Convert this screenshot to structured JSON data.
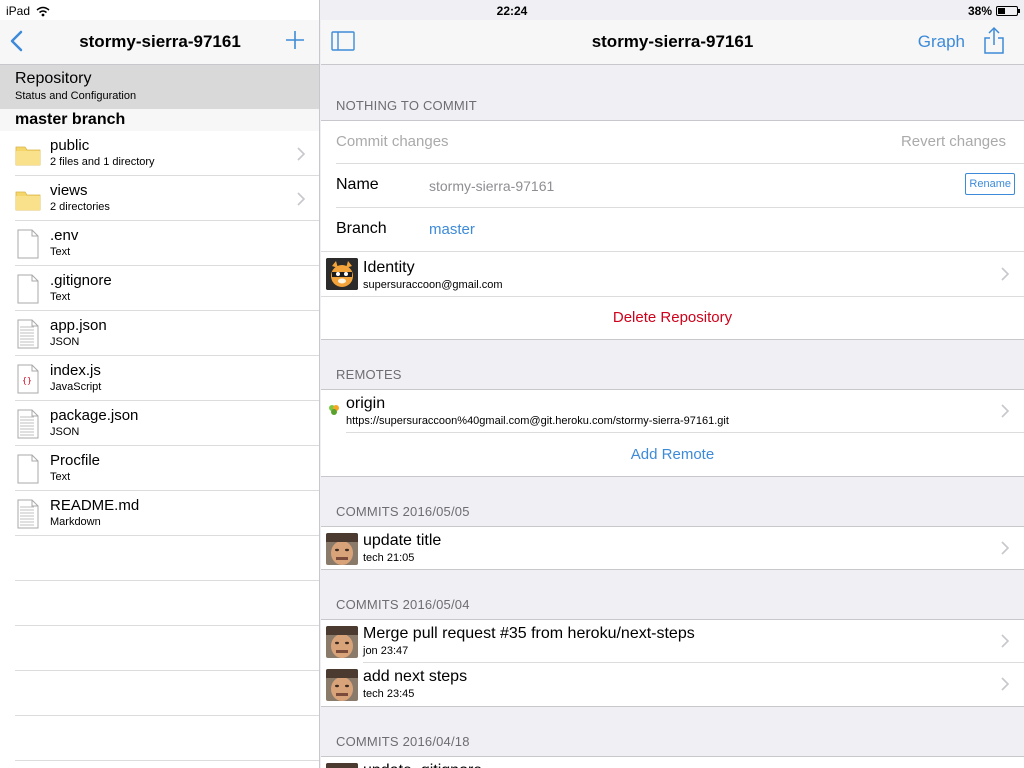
{
  "status_bar": {
    "device": "iPad",
    "time": "22:24",
    "battery_percent": "38%",
    "battery_level": 0.38
  },
  "left_pane": {
    "nav_title": "stormy-sierra-97161",
    "repository_row": {
      "title": "Repository",
      "subtitle": "Status and Configuration"
    },
    "branch_header": "master branch",
    "files": [
      {
        "name": "public",
        "subtitle": "2 files and 1 directory",
        "icon": "folder-icon",
        "has_chevron": true
      },
      {
        "name": "views",
        "subtitle": "2 directories",
        "icon": "folder-icon",
        "has_chevron": true
      },
      {
        "name": ".env",
        "subtitle": "Text",
        "icon": "blank-file-icon",
        "has_chevron": false
      },
      {
        "name": ".gitignore",
        "subtitle": "Text",
        "icon": "blank-file-icon",
        "has_chevron": false
      },
      {
        "name": "app.json",
        "subtitle": "JSON",
        "icon": "text-file-icon",
        "has_chevron": false
      },
      {
        "name": "index.js",
        "subtitle": "JavaScript",
        "icon": "code-file-icon",
        "has_chevron": false
      },
      {
        "name": "package.json",
        "subtitle": "JSON",
        "icon": "text-file-icon",
        "has_chevron": false
      },
      {
        "name": "Procfile",
        "subtitle": "Text",
        "icon": "blank-file-icon",
        "has_chevron": false
      },
      {
        "name": "README.md",
        "subtitle": "Markdown",
        "icon": "text-file-icon",
        "has_chevron": false
      }
    ]
  },
  "right_pane": {
    "nav_title": "stormy-sierra-97161",
    "graph_label": "Graph",
    "status_section": {
      "header": "NOTHING TO COMMIT",
      "commit_changes": "Commit changes",
      "revert_changes": "Revert changes",
      "name_label": "Name",
      "name_value": "stormy-sierra-97161",
      "rename_label": "Rename",
      "branch_label": "Branch",
      "branch_value": "master",
      "identity_title": "Identity",
      "identity_email": "supersuraccoon@gmail.com",
      "delete_label": "Delete Repository"
    },
    "remotes_section": {
      "header": "REMOTES",
      "remote_name": "origin",
      "remote_url": "https://supersuraccoon%40gmail.com@git.heroku.com/stormy-sierra-97161.git",
      "add_remote_label": "Add Remote"
    },
    "commit_groups": [
      {
        "header": "COMMITS 2016/05/05",
        "commits": [
          {
            "title": "update title",
            "meta": "tech 21:05"
          }
        ]
      },
      {
        "header": "COMMITS 2016/05/04",
        "commits": [
          {
            "title": "Merge pull request #35 from heroku/next-steps",
            "meta": "jon 23:47"
          },
          {
            "title": "add next steps",
            "meta": "tech 23:45"
          }
        ]
      },
      {
        "header": "COMMITS 2016/04/18",
        "commits": [
          {
            "title": "update .gitignore",
            "meta": ""
          }
        ]
      }
    ]
  },
  "colors": {
    "accent_blue": "#3d8bd8",
    "destructive_red": "#d0021b",
    "selected_row_gray": "#d9d9d9",
    "folder_yellow": "#f5d66b"
  }
}
